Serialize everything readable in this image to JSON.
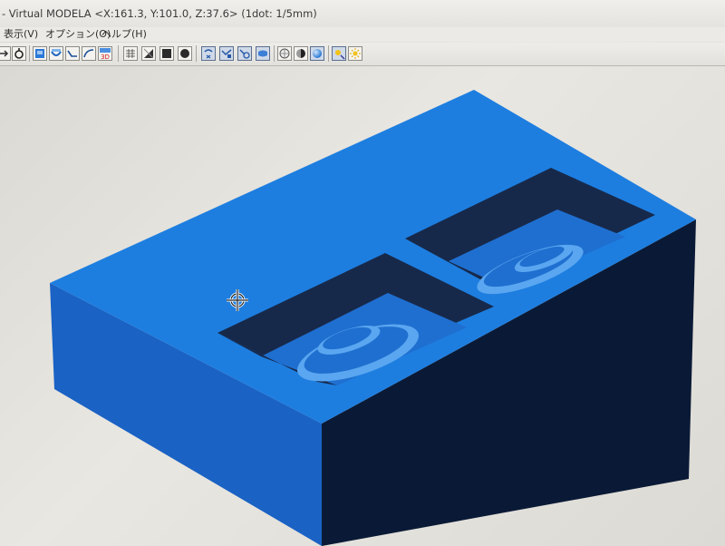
{
  "window": {
    "title": "- Virtual MODELA <X:161.3, Y:101.0, Z:37.6> (1dot: 1/5mm)"
  },
  "menu": {
    "items": [
      {
        "label": "表示(V)"
      },
      {
        "label": "オプション(O)"
      },
      {
        "label": "ヘルプ(H)"
      }
    ]
  },
  "toolbar": {
    "buttons": [
      {
        "icon": "arrow-icon"
      },
      {
        "icon": "tool-icon"
      },
      {
        "icon": "box-view-icon"
      },
      {
        "icon": "cut-icon"
      },
      {
        "icon": "path-icon"
      },
      {
        "icon": "curve-icon"
      },
      {
        "icon": "3d-view-icon",
        "label": "3D"
      },
      {
        "icon": "grid-icon"
      },
      {
        "icon": "edge-icon"
      },
      {
        "icon": "solid-square-icon"
      },
      {
        "icon": "solid-circle-icon"
      },
      {
        "icon": "rotate-icon"
      },
      {
        "icon": "pan-icon"
      },
      {
        "icon": "zoom-icon"
      },
      {
        "icon": "fit-view-icon"
      },
      {
        "icon": "globe-icon"
      },
      {
        "icon": "shade-icon"
      },
      {
        "icon": "sphere-icon"
      },
      {
        "icon": "light-icon"
      },
      {
        "icon": "sun-icon"
      }
    ]
  },
  "viewport": {
    "model_colors": {
      "top": "#1d7ee0",
      "left_side": "#1a62c4",
      "front_side": "#0a1a36",
      "cavity_wall": "#17294a",
      "cavity_floor": "#1f6fd0",
      "ridge": "#5aa6f0"
    },
    "cursor_icon": "move-cursor-icon"
  }
}
